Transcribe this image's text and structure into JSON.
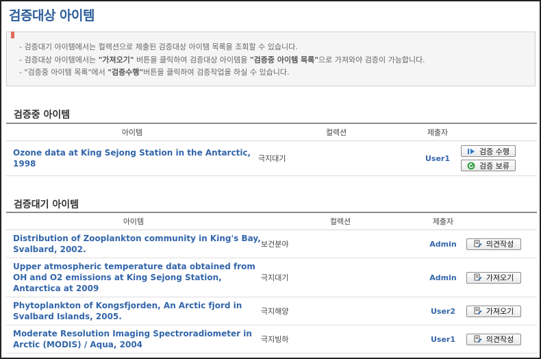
{
  "page": {
    "title": "검증대상 아이템"
  },
  "notice": {
    "line1": "- 검증대기 아이템에서는 컬렉션으로 제출된 검증대상 아이템 목록을 조회할 수 있습니다.",
    "line2_a": "- 검증대상 아이템에서는 ",
    "line2_b": "\"가져오기\"",
    "line2_c": " 버튼을 클릭하여 검증대상 아이템을 ",
    "line2_d": "\"검증중 아이템 목록\"",
    "line2_e": "으로 가져와야 검증이 가능합니다.",
    "line3_a": "- \"검증중 아이템 목록\"에서 ",
    "line3_b": "\"검증수행\"",
    "line3_c": "버튼을 클릭하여 검증작업을 하실 수 있습니다."
  },
  "in_review": {
    "title": "검증중 아이템",
    "columns": {
      "item": "아이템",
      "collection": "컬렉션",
      "submitter": "제출자"
    },
    "rows": [
      {
        "item": "Ozone data at King Sejong Station in the Antarctic, 1998",
        "collection": "극지대기",
        "submitter": "User1",
        "action1": "검증 수행",
        "action2": "검증 보류"
      }
    ]
  },
  "pending": {
    "title": "검증대기 아이템",
    "columns": {
      "item": "아이템",
      "collection": "컬렉션",
      "submitter": "제출자"
    },
    "rows": [
      {
        "item": "Distribution of Zooplankton community in King's Bay, Svalbard, 2002.",
        "collection": "보건분야",
        "submitter": "Admin",
        "action": "의견작성"
      },
      {
        "item": "Upper atmospheric temperature data obtained from OH and O2 emissions at King Sejong Station, Antarctica at 2009",
        "collection": "극지대기",
        "submitter": "Admin",
        "action": "가져오기"
      },
      {
        "item": "Phytoplankton of Kongsfjorden, An Arctic fjord in Svalbard Islands, 2005.",
        "collection": "극지해양",
        "submitter": "User2",
        "action": "가져오기"
      },
      {
        "item": "Moderate Resolution Imaging Spectroradiometer in Arctic (MODIS) / Aqua, 2004",
        "collection": "극지빙하",
        "submitter": "User1",
        "action": "의견작성"
      }
    ]
  },
  "icons": {
    "bookmark": "bookmark-icon",
    "run": "play-icon",
    "hold": "refresh-icon",
    "doc": "document-edit-icon"
  },
  "colors": {
    "title": "#2a5d9a",
    "link": "#3366aa",
    "bookmark": "#e06b5c"
  }
}
